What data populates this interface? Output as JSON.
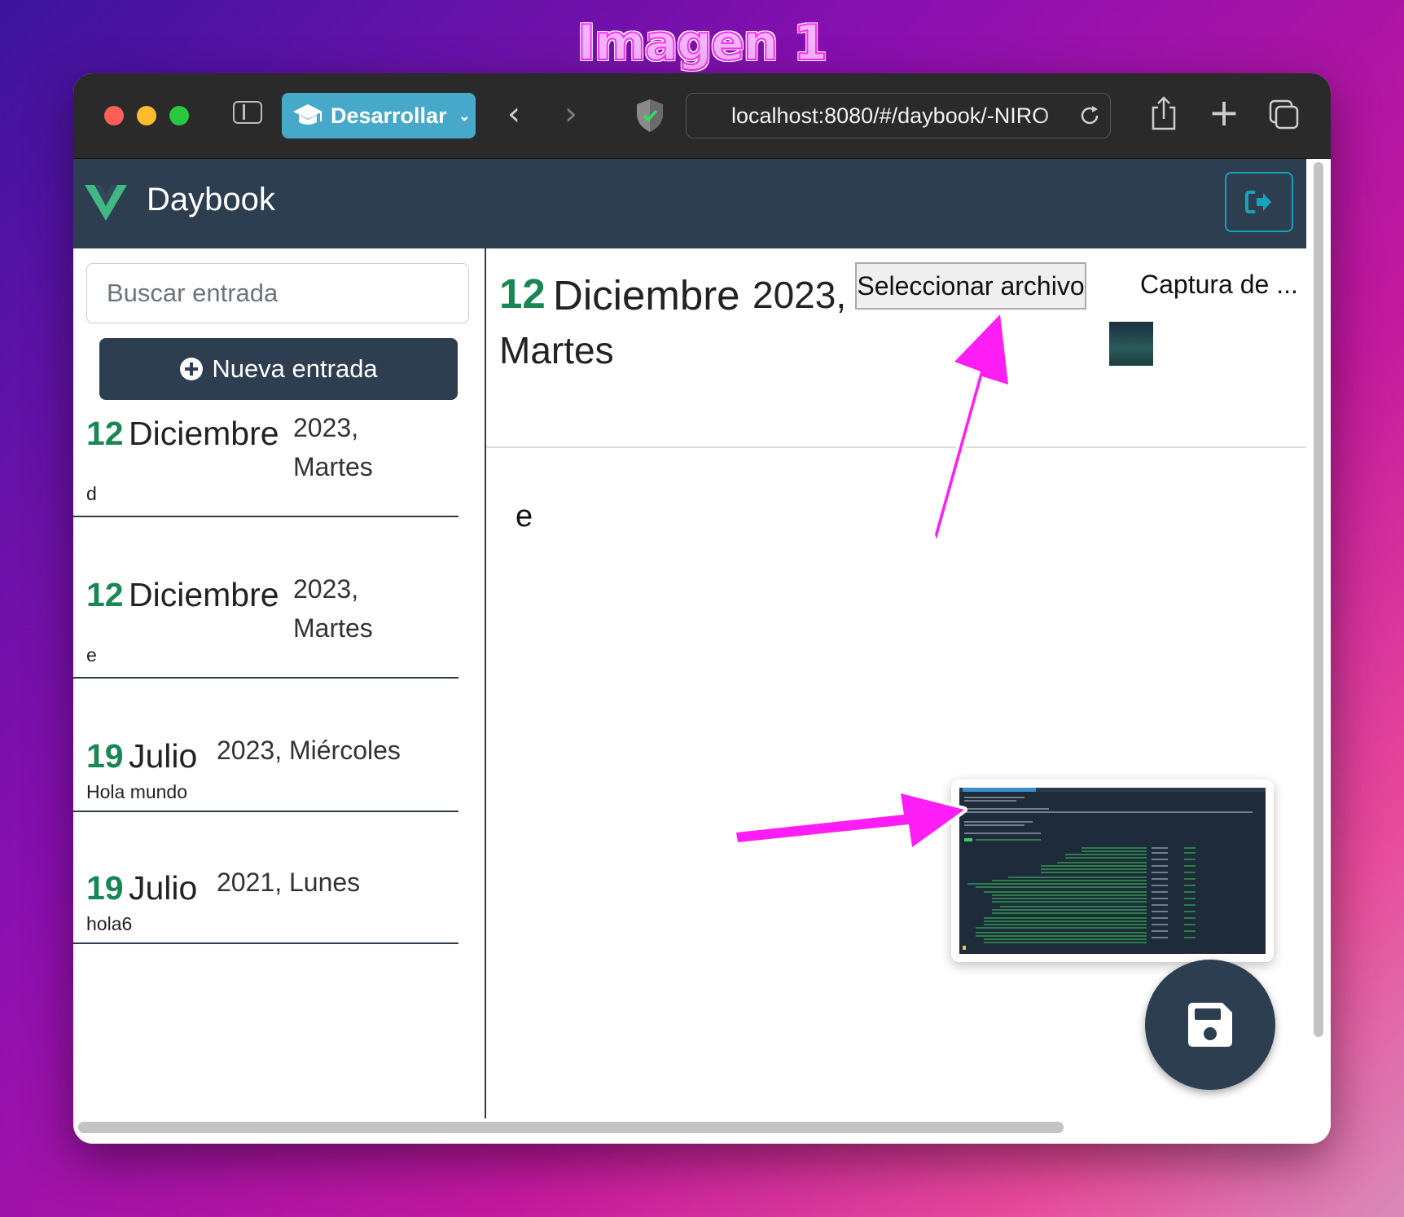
{
  "caption": "Imagen 1",
  "browser": {
    "profile_label": "Desarrollar",
    "url": "localhost:8080/#/daybook/-NIRO"
  },
  "app": {
    "brand": "Daybook",
    "search_placeholder": "Buscar entrada",
    "new_entry_label": "Nueva entrada"
  },
  "entries": [
    {
      "day": "12",
      "month": "Diciembre",
      "year_weekday_line1": "2023,",
      "year_weekday_line2": "Martes",
      "text": "d"
    },
    {
      "day": "12",
      "month": "Diciembre",
      "year_weekday_line1": "2023,",
      "year_weekday_line2": "Martes",
      "text": "e"
    },
    {
      "day": "19",
      "month": "Julio",
      "year_weekday_line1": "2023, Miércoles",
      "year_weekday_line2": "",
      "text": "Hola mundo"
    },
    {
      "day": "19",
      "month": "Julio",
      "year_weekday_line1": "2021, Lunes",
      "year_weekday_line2": "",
      "text": "hola6"
    }
  ],
  "detail": {
    "day": "12",
    "month": "Diciembre",
    "year": "2023,",
    "weekday": "Martes",
    "file_button_label": "Seleccionar archivo",
    "file_name": "Captura de ...",
    "body": "e"
  },
  "colors": {
    "navbar": "#2c3e50",
    "day_green": "#198754",
    "annotation_magenta": "#ff1df5",
    "logout_accent": "#17a2b8",
    "profile_button": "#46a9c9"
  },
  "icons": {
    "logout": "sign-out-icon",
    "save": "floppy-disk-icon",
    "new_entry": "plus-circle-icon",
    "profile": "graduation-cap-icon"
  }
}
